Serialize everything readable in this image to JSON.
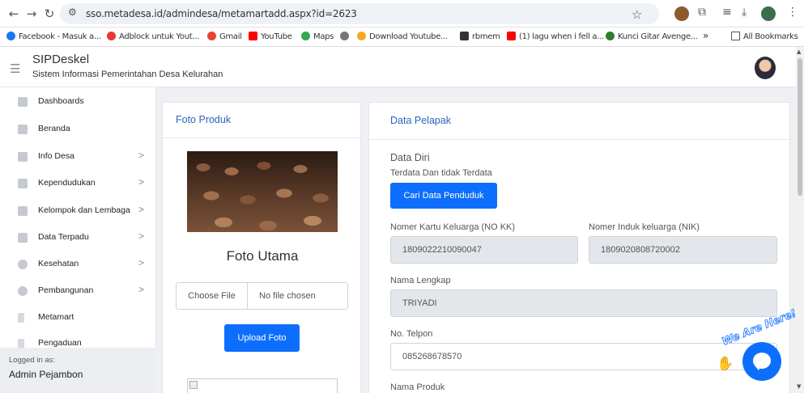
{
  "browser": {
    "url": "sso.metadesa.id/admindesa/metamartadd.aspx?id=2623",
    "bookmarks": [
      {
        "label": "Facebook - Masuk a...",
        "color": "#1877f2"
      },
      {
        "label": "Adblock untuk Yout...",
        "color": "#e53935"
      },
      {
        "label": "Gmail",
        "color": "#ea4335"
      },
      {
        "label": "YouTube",
        "color": "#ff0000"
      },
      {
        "label": "Maps",
        "color": "#34a853"
      },
      {
        "label": "",
        "color": "#777777"
      },
      {
        "label": "Download Youtube...",
        "color": "#f9a825"
      },
      {
        "label": "rbmem",
        "color": "#333333"
      },
      {
        "label": "(1) lagu when i fell a...",
        "color": "#ff0000"
      },
      {
        "label": "Kunci Gitar Avenge...",
        "color": "#2e7d32"
      }
    ],
    "more": "»",
    "all_bookmarks": "All Bookmarks"
  },
  "header": {
    "title": "SIPDeskel",
    "subtitle": "Sistem Informasi Pemerintahan Desa Kelurahan"
  },
  "sidebar": {
    "items": [
      {
        "label": "Dashboards",
        "chevron": ""
      },
      {
        "label": "Beranda",
        "chevron": ""
      },
      {
        "label": "Info Desa",
        "chevron": ">"
      },
      {
        "label": "Kependudukan",
        "chevron": ">"
      },
      {
        "label": "Kelompok dan Lembaga",
        "chevron": ">"
      },
      {
        "label": "Data Terpadu",
        "chevron": ">"
      },
      {
        "label": "Kesehatan",
        "chevron": ">"
      },
      {
        "label": "Pembangunan",
        "chevron": ">"
      },
      {
        "label": "Metamart",
        "chevron": ""
      },
      {
        "label": "Pengaduan",
        "chevron": ""
      }
    ],
    "logged_caption": "Logged in as:",
    "logged_name": "Admin Pejambon"
  },
  "foto_card": {
    "title": "Foto Produk",
    "caption": "Foto Utama",
    "choose_file": "Choose File",
    "no_file": "No file chosen",
    "upload_button": "Upload Foto"
  },
  "pelapak_card": {
    "title": "Data Pelapak",
    "section_title": "Data Diri",
    "section_sub": "Terdata Dan tidak Terdata",
    "search_button": "Cari Data Penduduk",
    "no_kk_label": "Nomer Kartu Keluarga (NO KK)",
    "no_kk_value": "1809022210090047",
    "nik_label": "Nomer Induk keluarga (NIK)",
    "nik_value": "1809020808720002",
    "nama_label": "Nama Lengkap",
    "nama_value": "TRIYADI",
    "telpon_label": "No. Telpon",
    "telpon_value": "085268678570",
    "produk_label": "Nama Produk"
  },
  "chat": {
    "tag": "We Are Here!"
  },
  "colors": {
    "primary": "#0d6efd",
    "card_title": "#2c63b8"
  }
}
